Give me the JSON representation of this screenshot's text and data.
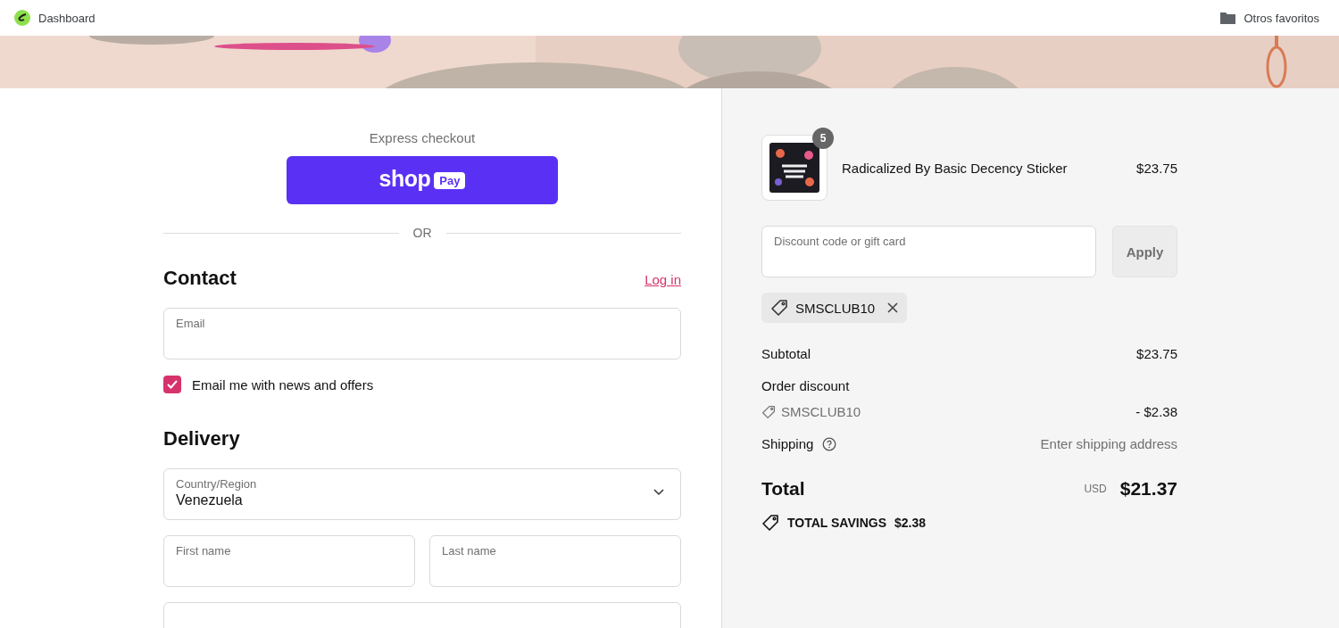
{
  "bookmarks_bar": {
    "left": {
      "label": "Dashboard"
    },
    "right": {
      "label": "Otros favoritos"
    }
  },
  "express_checkout": {
    "heading": "Express checkout",
    "button": {
      "wordmark": "shop",
      "badge": "Pay"
    },
    "divider": "OR"
  },
  "contact": {
    "heading": "Contact",
    "login_link": "Log in",
    "email": {
      "placeholder": "Email"
    },
    "newsletter": {
      "label": "Email me with news and offers",
      "checked": true
    }
  },
  "delivery": {
    "heading": "Delivery",
    "country": {
      "label": "Country/Region",
      "value": "Venezuela"
    },
    "fields": [
      {
        "placeholder": "First name"
      },
      {
        "placeholder": "Last name"
      }
    ]
  },
  "summary": {
    "item": {
      "quantity": "5",
      "name": "Radicalized By Basic Decency Sticker",
      "price": "$23.75"
    },
    "discount": {
      "placeholder": "Discount code or gift card",
      "button": "Apply"
    },
    "applied_codes": [
      {
        "code": "SMSCLUB10"
      }
    ],
    "subtotal": {
      "label": "Subtotal",
      "value": "$23.75"
    },
    "order_discount": {
      "label": "Order discount",
      "code": "SMSCLUB10",
      "value": "- $2.38"
    },
    "shipping": {
      "label": "Shipping",
      "value": "Enter shipping address"
    },
    "total": {
      "label": "Total",
      "currency": "USD",
      "value": "$21.37"
    },
    "savings": {
      "label": "TOTAL SAVINGS",
      "value": "$2.38"
    }
  }
}
